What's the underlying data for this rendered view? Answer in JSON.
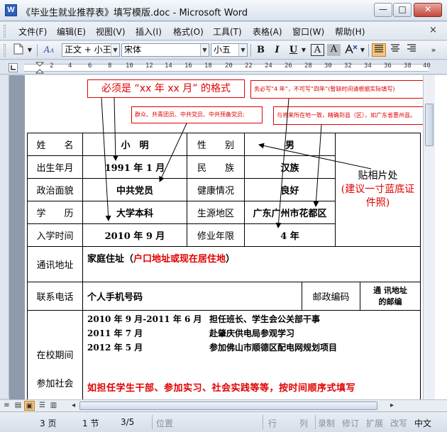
{
  "window": {
    "title": "《毕业生就业推荐表》填写模版.doc - Microsoft Word",
    "app_icon": "W",
    "buttons": {
      "minimize": "—",
      "maximize": "□",
      "close": "✕"
    }
  },
  "menu": {
    "items": [
      "文件(F)",
      "编辑(E)",
      "视图(V)",
      "插入(I)",
      "格式(O)",
      "工具(T)",
      "表格(A)",
      "窗口(W)",
      "帮助(H)"
    ],
    "close_doc": "×"
  },
  "toolbar": {
    "style": "正文 + 小王",
    "font": "宋体",
    "size": "小五",
    "bold": "B",
    "italic": "I",
    "underline": "U",
    "char_border": "A",
    "char_shade": "A"
  },
  "ruler": {
    "numbers": [
      "2",
      "4",
      "6",
      "8",
      "10",
      "12",
      "14",
      "16",
      "18",
      "20",
      "22",
      "24",
      "26",
      "28",
      "30",
      "32",
      "34",
      "36",
      "38",
      "40"
    ]
  },
  "annotations": {
    "date_format": "必须是 “xx 年 xx 月” 的格式",
    "year_note": "务必写“4 年”，不可写“四年”(暂缺时间请根据实际填写)",
    "party_note": "群众、共青团员、中共党员、中共预备党员;",
    "region_note": "与将来所在地一致，精确到县（区），如广东省惠州县。",
    "photo_line1": "贴相片处",
    "photo_line2": "(建议一寸蓝底证",
    "photo_line3": "件照)"
  },
  "form": {
    "name_label": "姓　　名",
    "name_value": "小　明",
    "gender_label": "性　　别",
    "gender_value": "男",
    "birth_label": "出生年月",
    "birth_value": "1991 年 1 月",
    "ethnic_label": "民　　族",
    "ethnic_value": "汉族",
    "politics_label": "政治面貌",
    "politics_value": "中共党员",
    "health_label": "健康情况",
    "health_value": "良好",
    "edu_label": "学　　历",
    "edu_value": "大学本科",
    "origin_label": "生源地区",
    "origin_value": "广东广州市花都区",
    "enroll_label": "入学时间",
    "enroll_value": "2010 年 9 月",
    "years_label": "修业年限",
    "years_value": "4 年",
    "address_label": "通讯地址",
    "address_prefix": "家庭住址（",
    "address_hint": "户口地址或现在居住地",
    "address_suffix": "）",
    "phone_label": "联系电话",
    "phone_value": "个人手机号码",
    "postcode_label": "邮政编码",
    "postcode_value_1": "通 讯地址",
    "postcode_value_2": "的邮编",
    "school_label": "在校期间",
    "social_label": "参加社会",
    "activities": [
      {
        "date": "2010 年 9 月-2011 年 6 月",
        "text": "担任班长、学生会公关部干事"
      },
      {
        "date": "2011 年 7 月",
        "text": "赴肇庆供电局参观学习"
      },
      {
        "date": "2012 年 5 月",
        "text": "参加佛山市顺德区配电网规划项目"
      }
    ],
    "activities_hint": "如担任学生干部、参加实习、社会实践等等，按时间顺序式填写"
  },
  "status": {
    "page": "3 页",
    "section": "1 节",
    "pages": "3/5",
    "position": "位置",
    "line": "行",
    "col": "列",
    "rec": "录制",
    "trk": "修订",
    "ext": "扩展",
    "ovr": "改写",
    "lang": "中文"
  }
}
